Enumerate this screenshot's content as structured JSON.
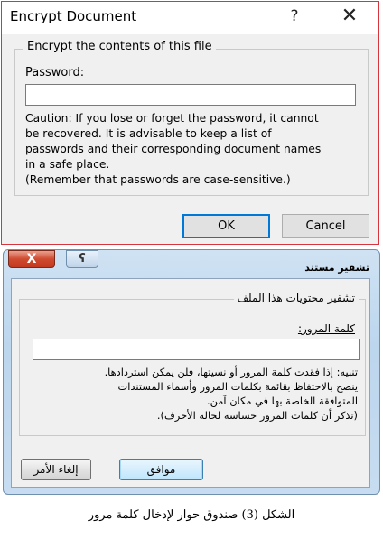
{
  "dialog_en": {
    "title": "Encrypt Document",
    "help_glyph": "?",
    "close_glyph": "✕",
    "group_label": "Encrypt the contents of this file",
    "password_label": "Password:",
    "password_value": "",
    "caution_line1": "Caution: If you lose or forget the password, it cannot",
    "caution_line2": "be recovered. It is advisable to keep a list of",
    "caution_line3": "passwords and their corresponding document names",
    "caution_line4": "in a safe place.",
    "caution_line5": "(Remember that passwords are case-sensitive.)",
    "ok_label": "OK",
    "cancel_label": "Cancel",
    "border_color": "#d8343d",
    "accent_color": "#0078d7"
  },
  "dialog_ar": {
    "title": "تشفير مستند",
    "close_glyph": "X",
    "help_glyph": "ʕ",
    "group_label": "تشفير محتويات هذا الملف",
    "password_label": "كلمة المرور:",
    "password_value": "",
    "caution_line1": "تنبيه: إذا فقدت كلمة المرور أو نسيتها، فلن يمكن استردادها.",
    "caution_line2": "ينصح بالاحتفاظ بقائمة بكلمات المرور وأسماء المستندات",
    "caution_line3": "المتوافقة الخاصة بها في مكان آمن.",
    "caution_line4": "(تذكر أن كلمات المرور حساسة لحالة الأحرف).",
    "ok_label": "موافق",
    "cancel_label": "إلغاء الأمر"
  },
  "caption": "الشكل (3) صندوق حوار لإدخال كلمة مرور"
}
